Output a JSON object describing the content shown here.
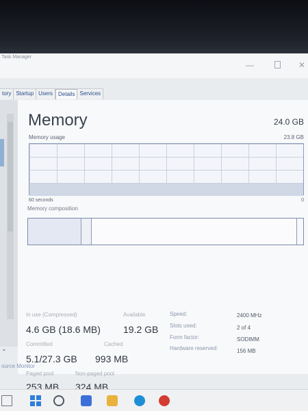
{
  "window": {
    "app_title": "Task Manager",
    "controls": {
      "minimize": "—",
      "close": "✕"
    }
  },
  "tabs": [
    "tory",
    "Startup",
    "Users",
    "Details",
    "Services"
  ],
  "memory": {
    "heading": "Memory",
    "total": "24.0 GB",
    "usage_label": "Memory usage",
    "usage_max": "23.8 GB",
    "time_axis_label": "60 seconds",
    "min_label": "0",
    "composition_label": "Memory composition",
    "usage_fraction": 0.19
  },
  "stats": {
    "in_use": {
      "label": "In use (Compressed)",
      "value": "4.6 GB (18.6 MB)"
    },
    "available": {
      "label": "Available",
      "value": "19.2 GB"
    },
    "committed": {
      "label": "Committed",
      "value": "5.1/27.3 GB"
    },
    "cached": {
      "label": "Cached",
      "value": "993 MB"
    },
    "paged_pool": {
      "label": "Paged pool",
      "value": "253 MB"
    },
    "non_paged_pool": {
      "label": "Non-paged pool",
      "value": "324 MB"
    }
  },
  "specs": [
    {
      "label": "Speed:",
      "value": "2400 MHz"
    },
    {
      "label": "Slots used:",
      "value": "2 of 4"
    },
    {
      "label": "Form factor:",
      "value": "SODIMM"
    },
    {
      "label": "Hardware reserved:",
      "value": "156 MB"
    }
  ],
  "footer": {
    "resource_monitor": "ource Monitor",
    "chevron": "⌄"
  },
  "taskbar": {
    "icons": [
      "task-view-icon",
      "windows-start-icon",
      "search-icon",
      "store-icon",
      "file-explorer-icon",
      "edge-icon",
      "chrome-icon"
    ]
  },
  "colors": {
    "graph_border": "#8c9bb8",
    "composition_border": "#7b89a8",
    "accent_blue": "#2f7fd8"
  }
}
